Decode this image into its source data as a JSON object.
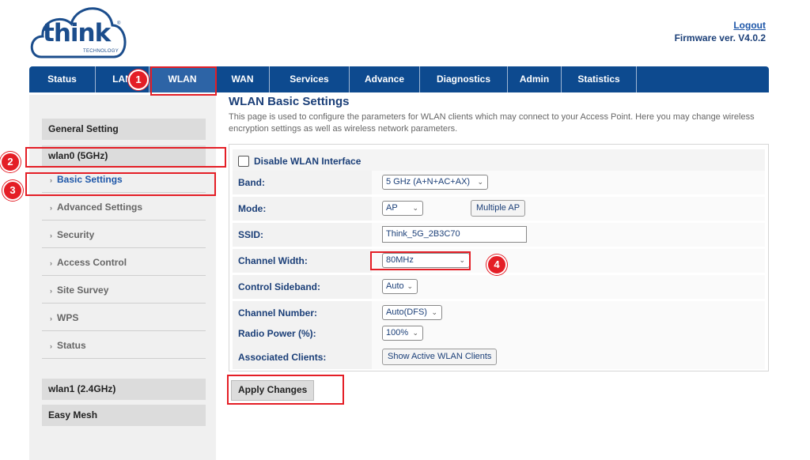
{
  "header": {
    "logo_text": "think",
    "logo_sub": "TECHNOLOGY",
    "logout": "Logout",
    "firmware": "Firmware ver. V4.0.2"
  },
  "nav": [
    {
      "label": "Status"
    },
    {
      "label": "LAN"
    },
    {
      "label": "WLAN",
      "active": true
    },
    {
      "label": "WAN"
    },
    {
      "label": "Services"
    },
    {
      "label": "Advance"
    },
    {
      "label": "Diagnostics"
    },
    {
      "label": "Admin"
    },
    {
      "label": "Statistics"
    }
  ],
  "sidebar": {
    "general": "General Setting",
    "wlan0": "wlan0 (5GHz)",
    "items": [
      {
        "label": "Basic Settings",
        "active": true
      },
      {
        "label": "Advanced Settings"
      },
      {
        "label": "Security"
      },
      {
        "label": "Access Control"
      },
      {
        "label": "Site Survey"
      },
      {
        "label": "WPS"
      },
      {
        "label": "Status"
      }
    ],
    "wlan1": "wlan1 (2.4GHz)",
    "easymesh": "Easy Mesh"
  },
  "main": {
    "title": "WLAN Basic Settings",
    "description": "This page is used to configure the parameters for WLAN clients which may connect to your Access Point. Here you may change wireless encryption settings as well as wireless network parameters.",
    "disable_label": "Disable WLAN Interface",
    "disable_checked": false,
    "band_label": "Band:",
    "band_value": "5 GHz (A+N+AC+AX)",
    "mode_label": "Mode:",
    "mode_value": "AP",
    "multiple_ap": "Multiple AP",
    "ssid_label": "SSID:",
    "ssid_value": "Think_5G_2B3C70",
    "channel_width_label": "Channel Width:",
    "channel_width_value": "80MHz",
    "sideband_label": "Control Sideband:",
    "sideband_value": "Auto",
    "channel_number_label": "Channel Number:",
    "channel_number_value": "Auto(DFS)",
    "radio_power_label": "Radio Power (%):",
    "radio_power_value": "100%",
    "clients_label": "Associated Clients:",
    "show_clients": "Show Active WLAN Clients",
    "apply": "Apply Changes"
  },
  "annotations": {
    "badge1": "1",
    "badge2": "2",
    "badge3": "3",
    "badge4": "4",
    "highlight_color": "#e41e26"
  },
  "colors": {
    "nav_bg": "#0d4a8f",
    "nav_active": "#2d64a6",
    "label_blue": "#1b3f78"
  }
}
